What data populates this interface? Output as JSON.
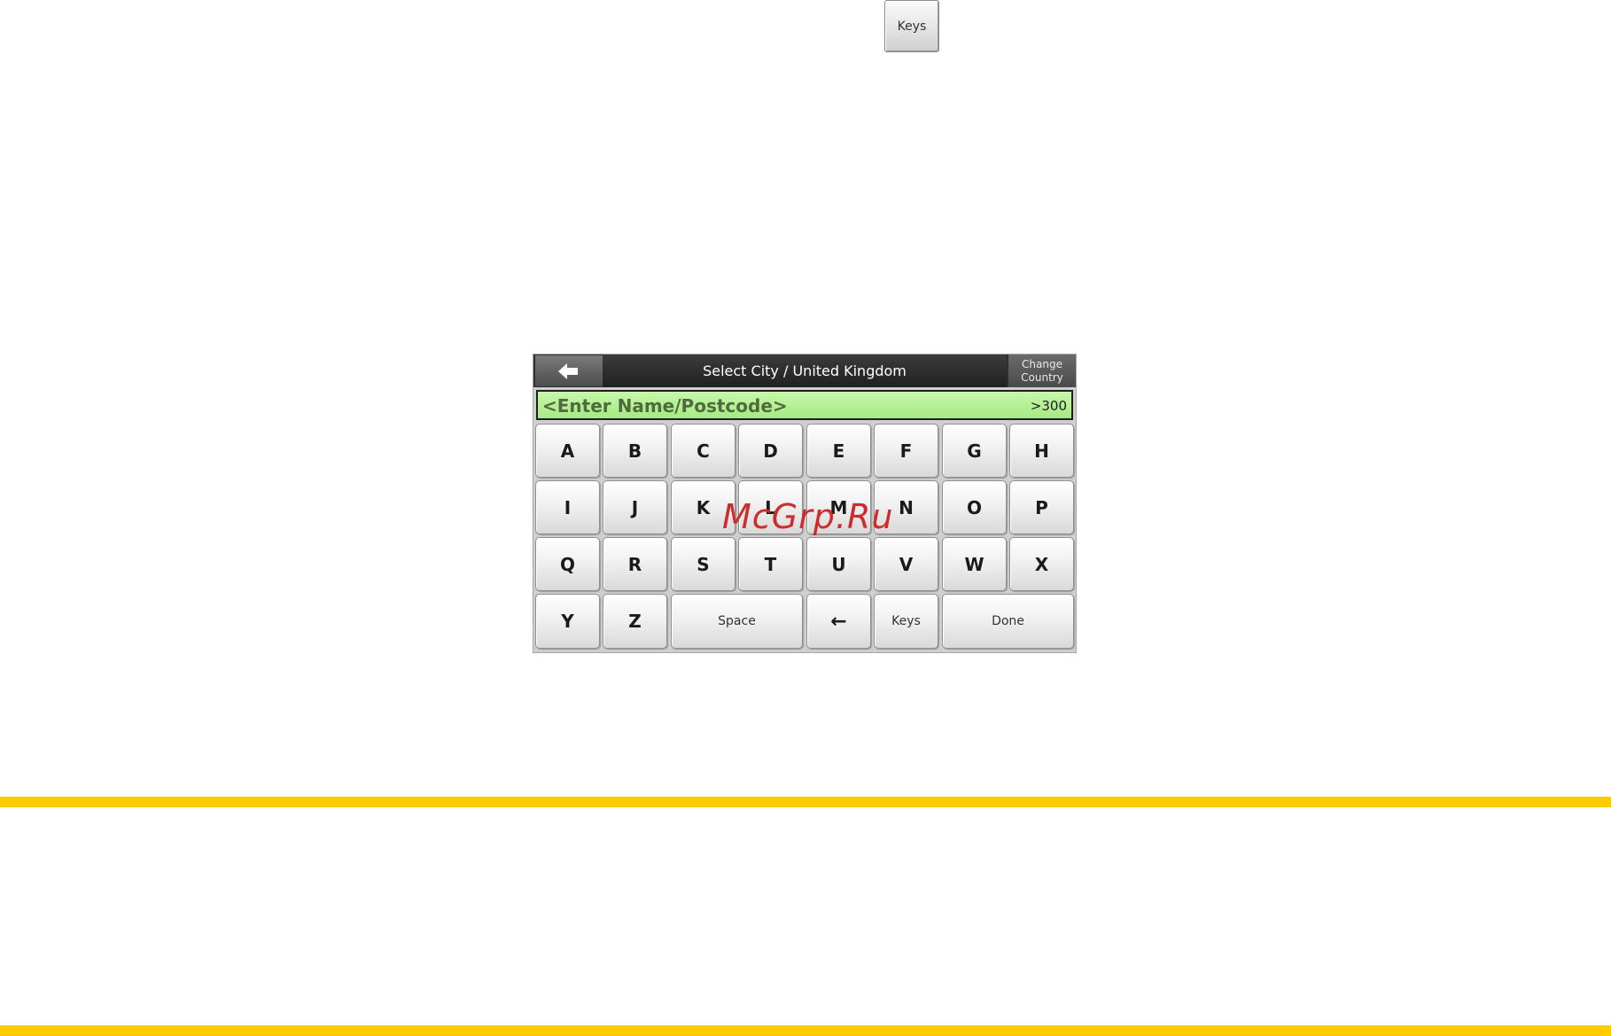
{
  "top_icon": {
    "label": "Keys"
  },
  "header": {
    "back_icon": "left-arrow-icon",
    "title": "Select City / United Kingdom",
    "change_country_line1": "Change",
    "change_country_line2": "Country"
  },
  "search": {
    "placeholder": "<Enter Name/Postcode>",
    "result_count": ">300"
  },
  "keyboard": {
    "row1": [
      "A",
      "B",
      "C",
      "D",
      "E",
      "F",
      "G",
      "H"
    ],
    "row2": [
      "I",
      "J",
      "K",
      "L",
      "M",
      "N",
      "O",
      "P"
    ],
    "row3": [
      "Q",
      "R",
      "S",
      "T",
      "U",
      "V",
      "W",
      "X"
    ],
    "row4": {
      "y": "Y",
      "z": "Z",
      "space": "Space",
      "backspace": "←",
      "keys": "Keys",
      "done": "Done"
    }
  },
  "watermark": "McGrp.Ru",
  "colors": {
    "accent_rule": "#ffcc00",
    "input_bg": "#b6f195",
    "titlebar": "#2f2f2f",
    "watermark": "#cc2c2c"
  }
}
